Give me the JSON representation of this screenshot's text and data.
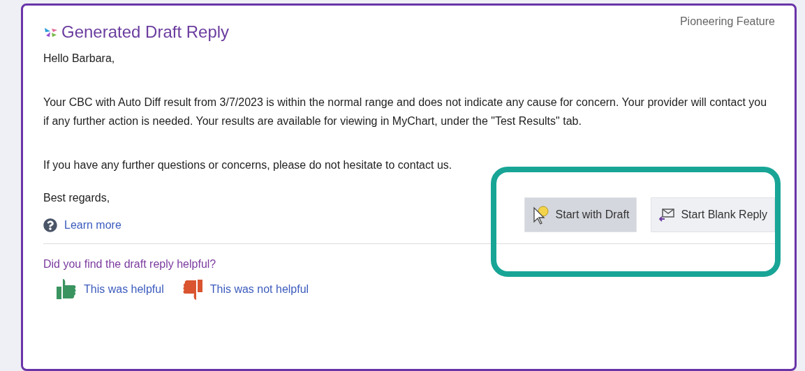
{
  "panel": {
    "title": "Generated Draft Reply",
    "badge": "Pioneering Feature"
  },
  "message": {
    "paragraphs": [
      "Hello Barbara,",
      "Your CBC with Auto Diff result from 3/7/2023 is within the normal range and does not indicate any cause for concern. Your provider will contact you if any further action is needed. Your results are available for viewing in MyChart, under the \"Test Results\" tab.",
      "If you have any further questions or concerns, please do not hesitate to contact us."
    ],
    "closing": "Best regards,"
  },
  "learn_more": "Learn more",
  "actions": [
    {
      "kind": "draft",
      "label": "Start with Draft",
      "hovered": true
    },
    {
      "kind": "blank",
      "label": "Start Blank Reply",
      "hovered": false
    }
  ],
  "feedback": {
    "question": "Did you find the draft reply helpful?",
    "options": [
      {
        "kind": "up",
        "label": "This was helpful"
      },
      {
        "kind": "down",
        "label": "This was not helpful"
      }
    ]
  },
  "highlight": {
    "on": true
  }
}
